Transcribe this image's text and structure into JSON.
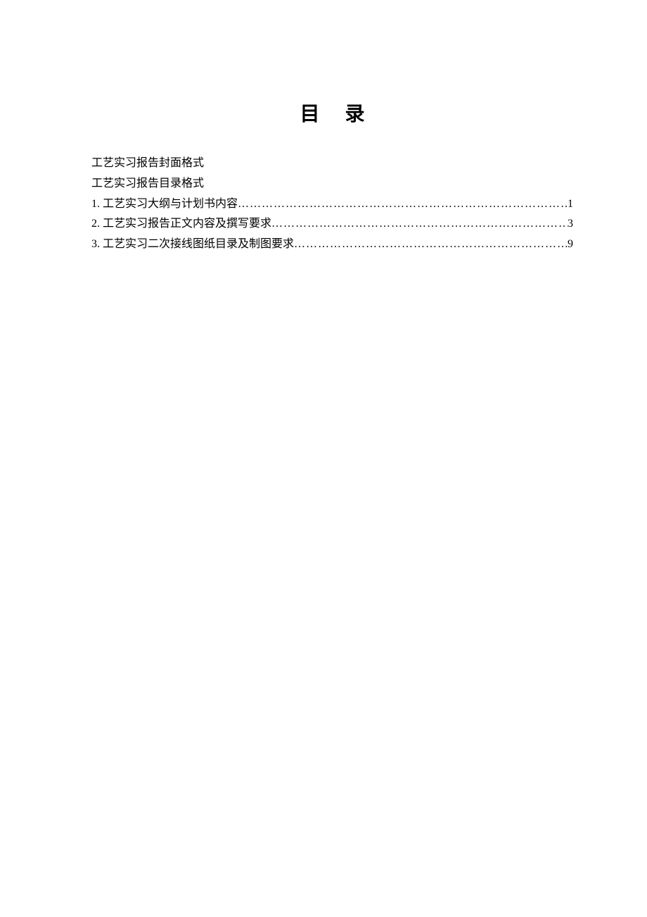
{
  "title": "目录",
  "toc": {
    "simple_lines": [
      "工艺实习报告封面格式",
      "工艺实习报告目录格式"
    ],
    "numbered_lines": [
      {
        "label": "1. 工艺实习大纲与计划书内容",
        "page": "1"
      },
      {
        "label": "2. 工艺实习报告正文内容及撰写要求",
        "page": "3"
      },
      {
        "label": "3. 工艺实习二次接线图纸目录及制图要求",
        "page": "9"
      }
    ]
  }
}
